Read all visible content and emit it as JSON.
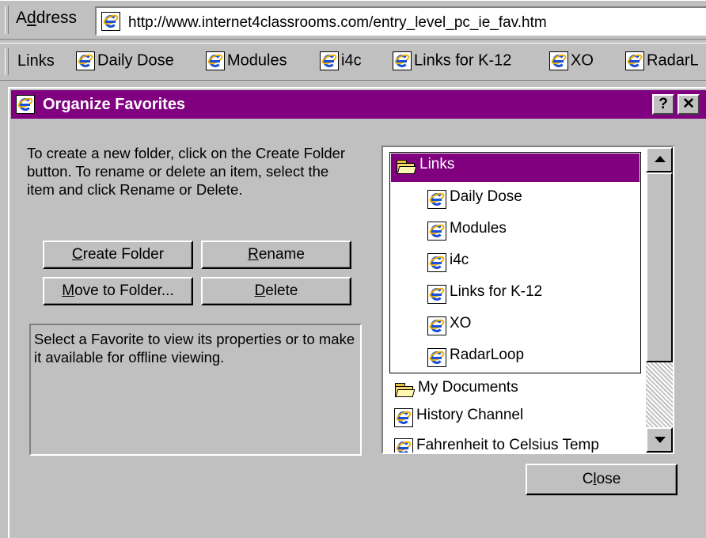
{
  "address_bar": {
    "label": "Address",
    "url": "http://www.internet4classrooms.com/entry_level_pc_ie_fav.htm"
  },
  "links_bar": {
    "label": "Links",
    "items": [
      {
        "label": "Daily Dose",
        "icon": "ie-page-icon"
      },
      {
        "label": "Modules",
        "icon": "ie-page-icon"
      },
      {
        "label": "i4c",
        "icon": "ie-page-icon"
      },
      {
        "label": "Links for K-12",
        "icon": "ie-page-icon"
      },
      {
        "label": "XO",
        "icon": "ie-page-icon"
      },
      {
        "label": "RadarL",
        "icon": "ie-page-icon"
      }
    ]
  },
  "dialog": {
    "title": "Organize Favorites",
    "help_label": "?",
    "close_x_label": "✕",
    "instructions": "To create a new folder, click on the Create Folder button. To rename or delete an item, select the item and click Rename or Delete.",
    "buttons": {
      "create_folder": {
        "pre": "",
        "key": "C",
        "post": "reate Folder"
      },
      "rename": {
        "pre": "",
        "key": "R",
        "post": "ename"
      },
      "move_to_folder": {
        "pre": "",
        "key": "M",
        "post": "ove to Folder..."
      },
      "delete": {
        "pre": "",
        "key": "D",
        "post": "elete"
      },
      "close": {
        "pre": "C",
        "key": "l",
        "post": "ose"
      }
    },
    "properties_text": "Select a Favorite to view its properties or to make it available for offline viewing.",
    "tree": {
      "items": [
        {
          "label": "Links",
          "icon": "open-folder-icon",
          "level": 0,
          "selected": true
        },
        {
          "label": "Daily Dose",
          "icon": "ie-page-icon",
          "level": 1
        },
        {
          "label": "Modules",
          "icon": "ie-page-icon",
          "level": 1
        },
        {
          "label": "i4c",
          "icon": "ie-page-icon",
          "level": 1
        },
        {
          "label": "Links for K-12",
          "icon": "ie-page-icon",
          "level": 1
        },
        {
          "label": "XO",
          "icon": "ie-page-icon",
          "level": 1
        },
        {
          "label": "RadarLoop",
          "icon": "ie-page-icon",
          "level": 1
        },
        {
          "label": "My Documents",
          "icon": "open-folder-icon",
          "level": 0
        },
        {
          "label": "History Channel",
          "icon": "ie-page-icon",
          "level": 0
        },
        {
          "label": "Fahrenheit to Celsius Temp",
          "icon": "ie-page-icon",
          "level": 0
        }
      ]
    }
  },
  "colors": {
    "title_bar": "#800080",
    "selection": "#800080",
    "face": "#c0c0c0"
  }
}
